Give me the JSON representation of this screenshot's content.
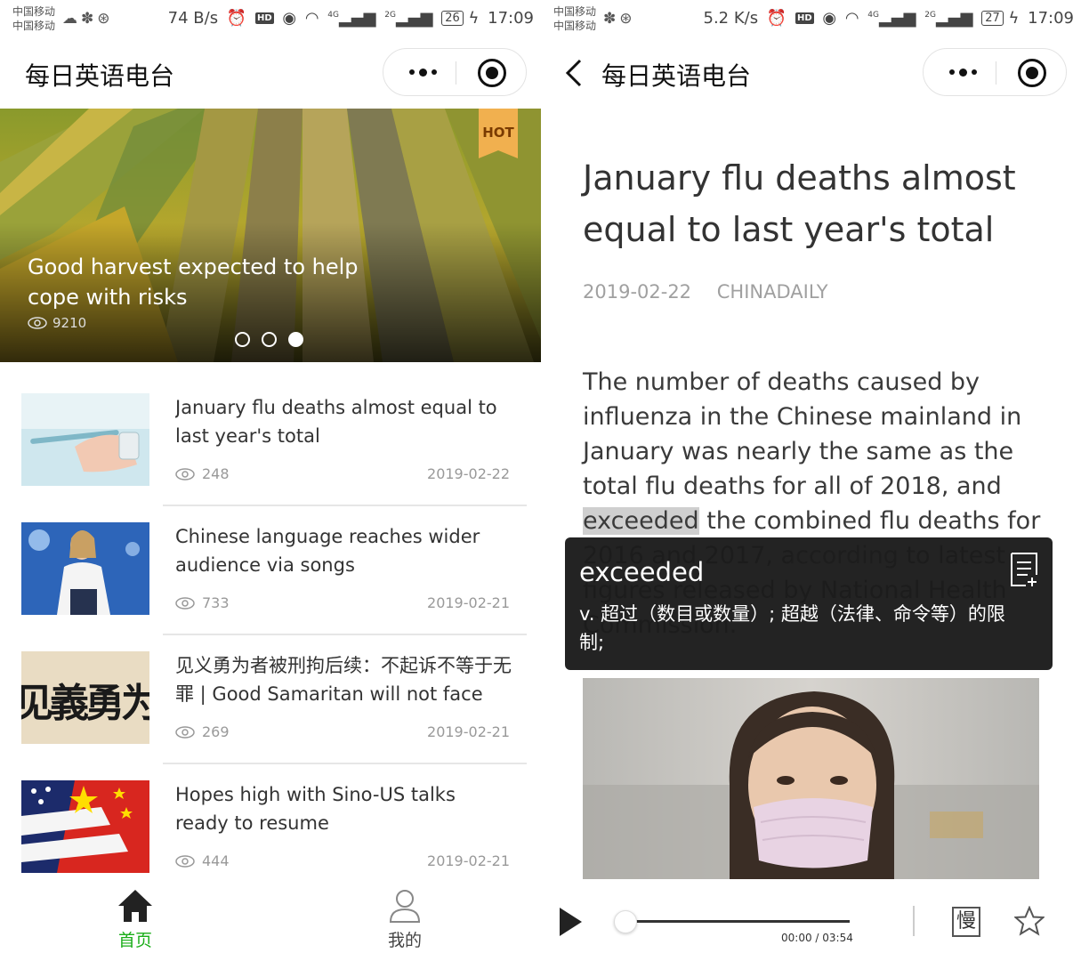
{
  "statusbar_left": {
    "carrier1": "中国移动",
    "carrier2": "中国移动",
    "speed": "74 B/s",
    "signal1": "4G",
    "signal2": "2G",
    "battery": "26",
    "time": "17:09"
  },
  "statusbar_right": {
    "carrier1": "中国移动",
    "carrier2": "中国移动",
    "speed": "5.2 K/s",
    "signal1": "4G",
    "signal2": "2G",
    "battery": "27",
    "time": "17:09"
  },
  "app": {
    "title": "每日英语电台"
  },
  "banner": {
    "badge": "HOT",
    "title": "Good harvest expected to help cope with risks",
    "views": "9210"
  },
  "articles": [
    {
      "title": "January flu deaths almost equal to last year's total",
      "views": "248",
      "date": "2019-02-22"
    },
    {
      "title": "Chinese language reaches wider audience via songs",
      "views": "733",
      "date": "2019-02-21"
    },
    {
      "title": "见义勇为者被刑拘后续：不起诉不等于无罪 | Good Samaritan will not face",
      "views": "269",
      "date": "2019-02-21"
    },
    {
      "title": "Hopes high with Sino-US talks ready to resume",
      "views": "444",
      "date": "2019-02-21"
    }
  ],
  "thumb_texts": {
    "calligraphy": "见義勇为"
  },
  "tabs": {
    "home": "首页",
    "mine": "我的"
  },
  "colors": {
    "accent": "#1aad19",
    "hot": "#f1b04f"
  },
  "article": {
    "title": "January flu deaths almost equal to last year's total",
    "date": "2019-02-22",
    "source": "CHINADAILY",
    "body_before": "The number of deaths caused by influenza in the Chinese mainland in January was nearly the same as the total flu deaths for all of 2018, and ",
    "body_highlight": "exceeded",
    "body_after": " the combined flu deaths for 2016 and 2017, according to latest figures released by National Health Commission."
  },
  "popup": {
    "word": "exceeded",
    "definition": "v. 超过（数目或数量）; 超越（法律、命令等）的限制;"
  },
  "player": {
    "time": "00:00 / 03:54",
    "slow_label": "慢",
    "progress": 0
  }
}
